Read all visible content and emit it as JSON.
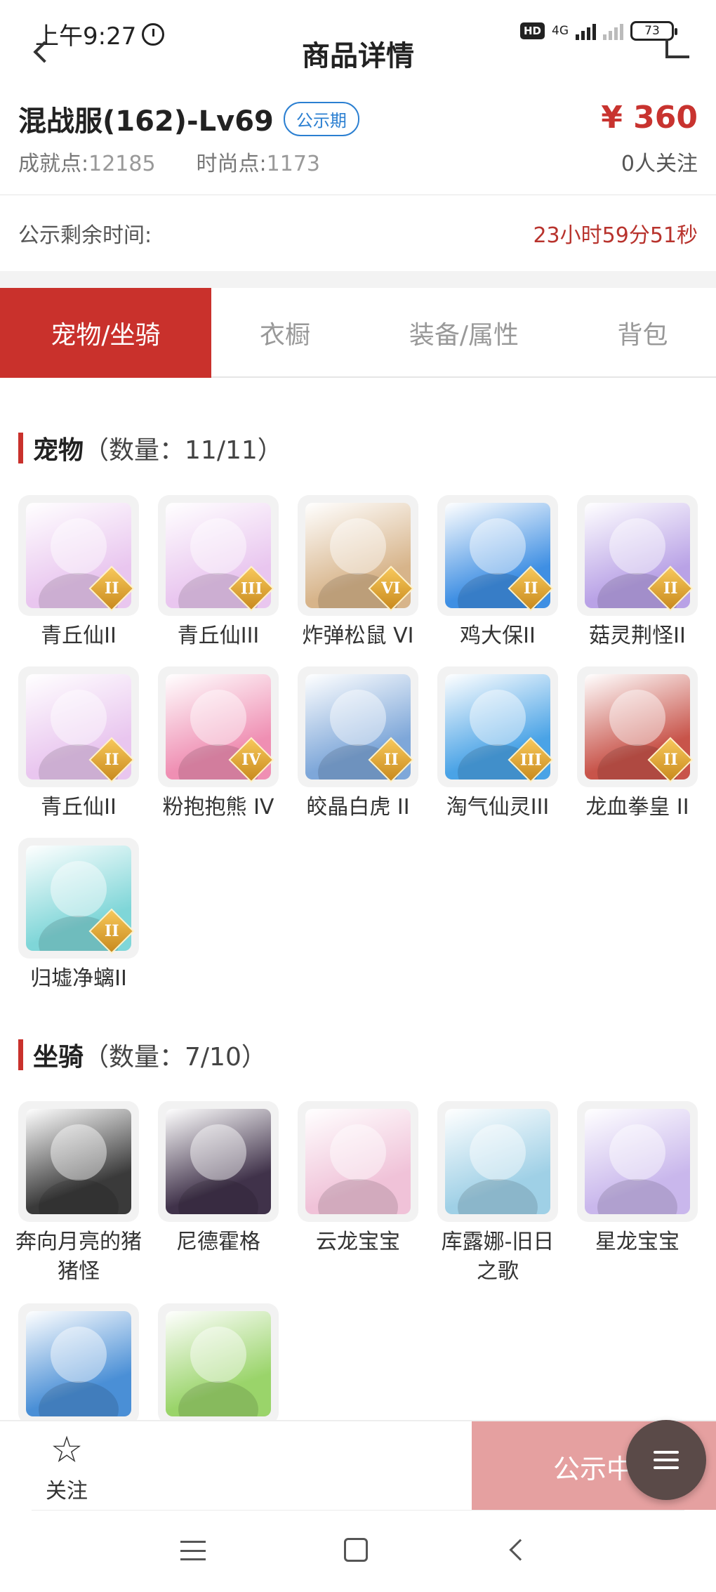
{
  "status_bar": {
    "time": "上午9:27",
    "hd": "HD",
    "network": "4G",
    "battery": "73"
  },
  "nav": {
    "title": "商品详情"
  },
  "product": {
    "name": "混战服(162)-Lv69",
    "badge": "公示期",
    "price": "¥ 360",
    "achievement_label": "成就点:",
    "achievement_value": "12185",
    "fashion_label": "时尚点:",
    "fashion_value": "1173",
    "followers": "0人关注"
  },
  "countdown": {
    "label": "公示剩余时间:",
    "value": "23小时59分51秒"
  },
  "tabs": [
    {
      "label": "宠物/坐骑",
      "active": true
    },
    {
      "label": "衣橱",
      "active": false
    },
    {
      "label": "装备/属性",
      "active": false
    },
    {
      "label": "背包",
      "active": false
    }
  ],
  "pets_section": {
    "title": "宠物",
    "count": "（数量：11/11）"
  },
  "pets": [
    {
      "name": "青丘仙II",
      "tier": "II",
      "color": "#e9c6ef"
    },
    {
      "name": "青丘仙III",
      "tier": "III",
      "color": "#e9c6ef"
    },
    {
      "name": "炸弹松鼠 VI",
      "tier": "VI",
      "color": "#d7b48a"
    },
    {
      "name": "鸡大保II",
      "tier": "II",
      "color": "#3f8fe3"
    },
    {
      "name": "菇灵荆怪II",
      "tier": "II",
      "color": "#b9a2e6"
    },
    {
      "name": "青丘仙II",
      "tier": "II",
      "color": "#e9c6ef"
    },
    {
      "name": "粉抱抱熊 IV",
      "tier": "IV",
      "color": "#ef8fb3"
    },
    {
      "name": "皎晶白虎 II",
      "tier": "II",
      "color": "#7ea7d9"
    },
    {
      "name": "淘气仙灵III",
      "tier": "III",
      "color": "#4aa3e6"
    },
    {
      "name": "龙血拳皇 II",
      "tier": "II",
      "color": "#c8544a"
    },
    {
      "name": "归墟净螭II",
      "tier": "II",
      "color": "#7fd6d8"
    }
  ],
  "mounts_section": {
    "title": "坐骑",
    "count": "（数量：7/10）"
  },
  "mounts": [
    {
      "name": "奔向月亮的猪猪怪",
      "color": "#3a3a3a"
    },
    {
      "name": "尼德霍格",
      "color": "#40324a"
    },
    {
      "name": "云龙宝宝",
      "color": "#f0c2d8"
    },
    {
      "name": "库露娜-旧日之歌",
      "color": "#9fd0e6"
    },
    {
      "name": "星龙宝宝",
      "color": "#c9b7ec"
    },
    {
      "name": "",
      "color": "#4a8fd6"
    },
    {
      "name": "",
      "color": "#9ad46a"
    }
  ],
  "action_bar": {
    "follow_label": "关注",
    "status_label": "公示中"
  },
  "colors": {
    "accent": "#c9312c",
    "price": "#c8332f",
    "badge": "#2b7fd1",
    "status_button": "#e5a0a0"
  },
  "icons": [
    "alarm-icon",
    "back-icon",
    "share-icon",
    "star-icon",
    "menu-icon",
    "home-icon",
    "back-nav-icon"
  ]
}
